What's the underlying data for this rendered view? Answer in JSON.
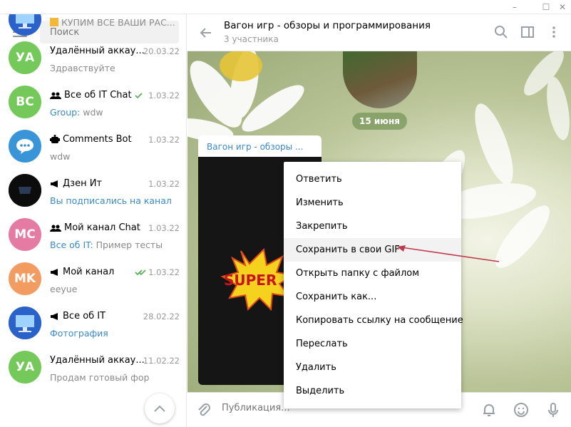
{
  "window": {
    "minimize": "–",
    "maximize": "☐",
    "close": "✕"
  },
  "sidebar": {
    "search_placeholder": "Поиск",
    "chats": [
      {
        "name": "",
        "time": "",
        "preview": "КУПИМ ВСЕ ВАШИ РАС...",
        "avatar_text": "",
        "avatar_color": "#e57aa2",
        "partial": true
      },
      {
        "name": "Удалённый аккау...",
        "time": "20.03.22",
        "preview": "Здравствуйте",
        "avatar_text": "УА",
        "avatar_color": "#74c95a"
      },
      {
        "name": "Все об IT Chat",
        "time": "1.03.22",
        "preview_highlight": "Group:",
        "preview": "wdw",
        "avatar_text": "BC",
        "avatar_color": "#74c95a",
        "type": "group",
        "read": true
      },
      {
        "name": "Comments Bot",
        "time": "1.03.22",
        "preview": "wdw",
        "avatar_text": "",
        "avatar_color": "#3a95d8",
        "type": "bot"
      },
      {
        "name": "Дзен Ит",
        "time": "1.03.22",
        "preview_highlight": "Вы подписались на канал",
        "preview": "",
        "avatar_text": "",
        "avatar_color": "#111111",
        "type": "channel"
      },
      {
        "name": "Мой канал Chat",
        "time": "1.03.22",
        "preview_highlight": "Все об IT:",
        "preview": "Пример тесты",
        "avatar_text": "MC",
        "avatar_color": "#e57aa2",
        "type": "group"
      },
      {
        "name": "Мой канал",
        "time": "1.03.22",
        "preview": "eeyue",
        "avatar_text": "MK",
        "avatar_color": "#f39c62",
        "type": "channel",
        "read": true
      },
      {
        "name": "Все об IT",
        "time": "28.02.22",
        "preview_highlight": "Фотография",
        "preview": "",
        "avatar_text": "",
        "avatar_color": "#1e4fa8",
        "type": "channel"
      },
      {
        "name": "Удалённый аккау...",
        "time": "11.02.22",
        "preview": "Продам готовый фор",
        "avatar_text": "УА",
        "avatar_color": "#74c95a"
      }
    ]
  },
  "header": {
    "title": "Вагон игр - обзоры и программирования",
    "subtitle": "3 участника"
  },
  "messages": {
    "date_label": "15 июня",
    "message_title": "Вагон игр - обзоры ...",
    "gif_text": "SUPER"
  },
  "composer": {
    "placeholder": "Публикация..."
  },
  "context_menu": {
    "items": [
      "Ответить",
      "Изменить",
      "Закрепить",
      "Сохранить в свои GIF",
      "Открыть папку с файлом",
      "Сохранить как...",
      "Копировать ссылку на сообщение",
      "Переслать",
      "Удалить",
      "Выделить"
    ],
    "active_index": 3
  },
  "colors": {
    "accent": "#3a8ac9",
    "read_check": "#4dae4f",
    "arrow": "#c0394b"
  }
}
